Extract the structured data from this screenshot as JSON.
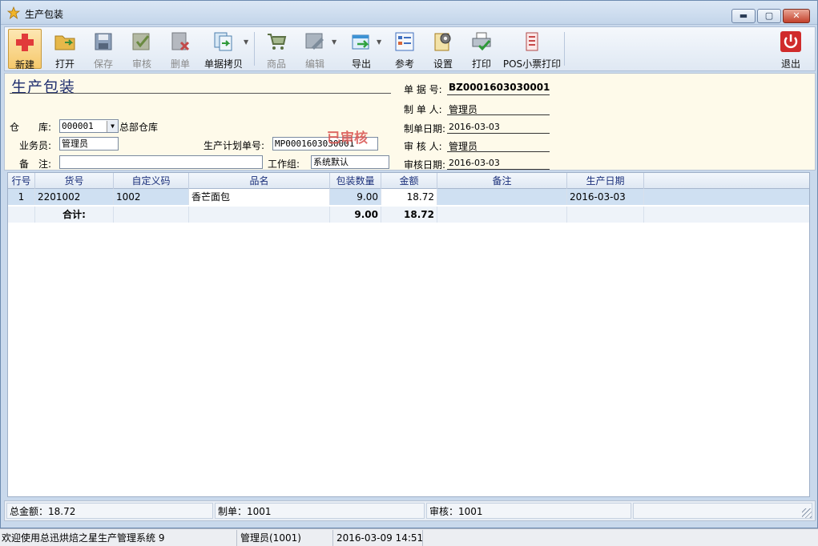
{
  "window": {
    "title": "生产包装",
    "controls": {
      "minimize": "▬",
      "maximize": "▢",
      "close": "✕"
    }
  },
  "toolbar": {
    "buttons": [
      {
        "label": "新建",
        "icon": "plus-icon",
        "color": "#e13a3a",
        "enabled": true
      },
      {
        "label": "打开",
        "icon": "folder-icon",
        "color": "#e6b84a",
        "enabled": true
      },
      {
        "label": "保存",
        "icon": "save-icon",
        "color": "#6b86a8",
        "enabled": false
      },
      {
        "label": "审核",
        "icon": "approve-icon",
        "color": "#7f9a55",
        "enabled": false
      },
      {
        "label": "删单",
        "icon": "delete-doc-icon",
        "color": "#8a8f98",
        "enabled": false
      },
      {
        "label": "单据拷贝",
        "icon": "copy-icon",
        "color": "#5aa0d8",
        "enabled": true
      },
      {
        "label": "商品",
        "icon": "cart-icon",
        "color": "#6aa05a",
        "enabled": false
      },
      {
        "label": "编辑",
        "icon": "edit-icon",
        "color": "#7a8b9c",
        "enabled": false
      },
      {
        "label": "导出",
        "icon": "export-icon",
        "color": "#3d92d4",
        "enabled": true
      },
      {
        "label": "参考",
        "icon": "reference-icon",
        "color": "#3f6fbf",
        "enabled": true
      },
      {
        "label": "设置",
        "icon": "settings-icon",
        "color": "#d8a53a",
        "enabled": true
      },
      {
        "label": "打印",
        "icon": "print-icon",
        "color": "#5ca84e",
        "enabled": true
      },
      {
        "label": "POS小票打印",
        "icon": "receipt-print-icon",
        "color": "#c74a4a",
        "enabled": true
      },
      {
        "label": "退出",
        "icon": "power-icon",
        "color": "#d02b2b",
        "enabled": true
      }
    ]
  },
  "form": {
    "title": "生产包装",
    "warehouse_label": "仓　　库:",
    "warehouse_code": "000001",
    "warehouse_name": "总部仓库",
    "salesperson_label": "业务员:",
    "salesperson_value": "管理员",
    "plan_no_label": "生产计划单号:",
    "plan_no_value": "MP0001603030001",
    "notes_label": "备　注:",
    "notes_value": "",
    "workgroup_label": "工作组:",
    "workgroup_value": "系统默认",
    "stamp_text": "已审核",
    "doc_no_label": "单 据 号:",
    "doc_no_value": "BZ0001603030001",
    "maker_label": "制 单 人:",
    "maker_value": "管理员",
    "make_date_label": "制单日期:",
    "make_date_value": "2016-03-03",
    "reviewer_label": "审 核 人:",
    "reviewer_value": "管理员",
    "review_date_label": "审核日期:",
    "review_date_value": "2016-03-03"
  },
  "grid": {
    "columns": [
      "行号",
      "货号",
      "自定义码",
      "品名",
      "包装数量",
      "金额",
      "备注",
      "生产日期"
    ],
    "rows": [
      {
        "line": "1",
        "sku": "2201002",
        "custom_code": "1002",
        "name": "香芒面包",
        "qty": "9.00",
        "amount": "18.72",
        "note": "",
        "date": "2016-03-03"
      }
    ],
    "total": {
      "label": "合计:",
      "qty": "9.00",
      "amount": "18.72"
    }
  },
  "summary": {
    "total_amount": "总金额：18.72",
    "maker": "制单：1001",
    "reviewer": "审核：1001",
    "empty": ""
  },
  "statusbar": {
    "welcome": "欢迎使用总迅烘焙之星生产管理系统 9",
    "user": "管理员(1001)",
    "datetime": "2016-03-09 14:51"
  }
}
